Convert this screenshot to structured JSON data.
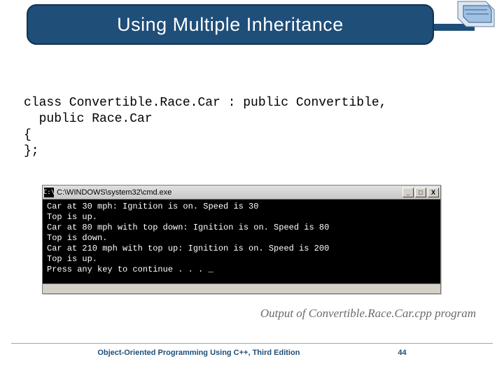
{
  "header": {
    "title": "Using Multiple Inheritance"
  },
  "code": {
    "line1": "class Convertible.Race.Car : public Convertible,",
    "line2": "  public Race.Car",
    "line3": "{",
    "line4": "};"
  },
  "cmd": {
    "icon_glyph": "C:\\",
    "title": "C:\\WINDOWS\\system32\\cmd.exe",
    "btn_min": "_",
    "btn_max": "□",
    "btn_close": "X",
    "out1": "Car at 30 mph: Ignition is on. Speed is 30",
    "out2": "Top is up.",
    "out3": "Car at 80 mph with top down: Ignition is on. Speed is 80",
    "out4": "Top is down.",
    "out5": "Car at 210 mph with top up: Ignition is on. Speed is 200",
    "out6": "Top is up.",
    "out7": "Press any key to continue . . . _"
  },
  "caption": "Output of Convertible.Race.Car.cpp program",
  "footer": {
    "book": "Object-Oriented Programming Using C++, Third Edition",
    "page": "44"
  },
  "icons": {
    "corner": "book-corner-icon",
    "cmd": "cmd-prompt-icon"
  }
}
